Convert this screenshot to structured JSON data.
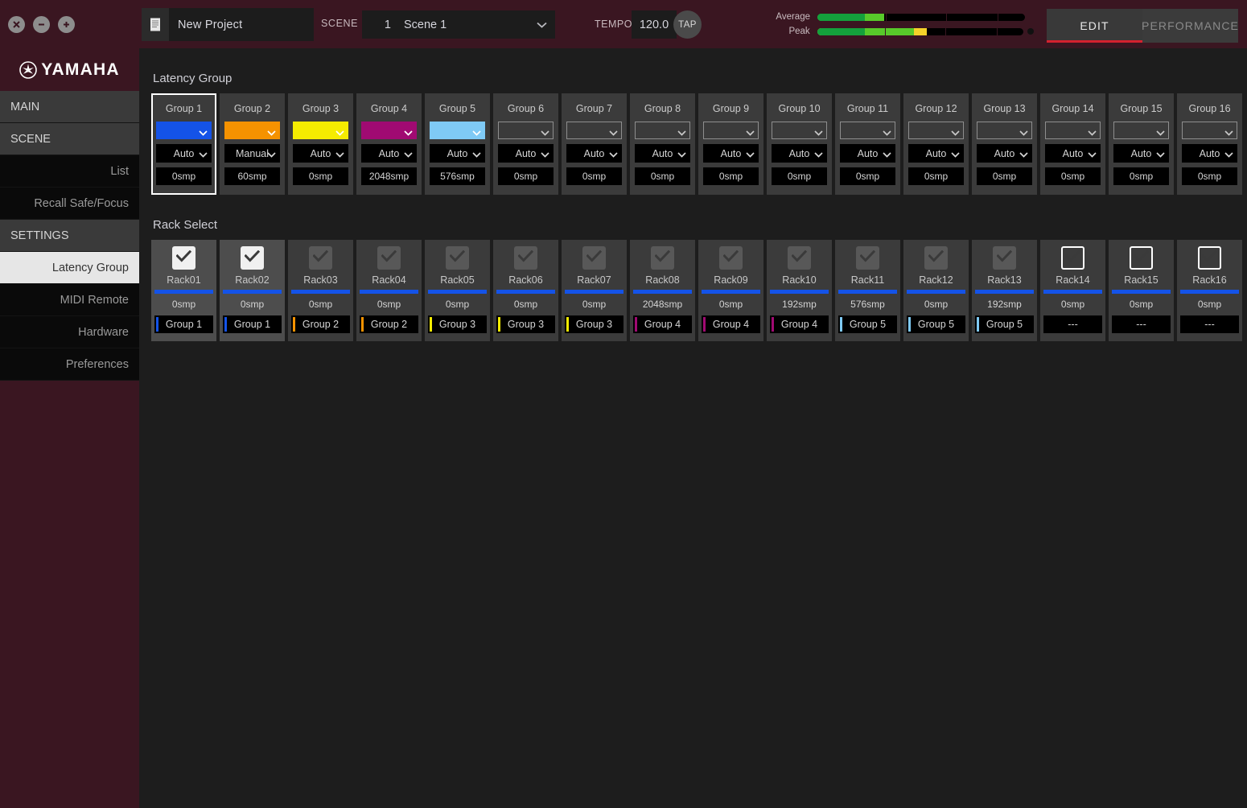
{
  "window": {
    "buttons": [
      {
        "name": "close",
        "glyph": "×"
      },
      {
        "name": "minimize",
        "glyph": "−"
      },
      {
        "name": "maximize",
        "glyph": "+"
      }
    ]
  },
  "header": {
    "project_name": "New Project",
    "project_icon": "document-icon",
    "scene_label": "SCENE",
    "scene_number": "1",
    "scene_name": "Scene 1",
    "tempo_label": "TEMPO",
    "tempo_value": "120.0",
    "tap_label": "TAP",
    "meters": [
      {
        "label": "Average",
        "value_pct": 32,
        "green_pct": 23,
        "lightgreen_pct": 32,
        "yellow_pct": 0,
        "has_dot": false
      },
      {
        "label": "Peak",
        "value_pct": 53,
        "green_pct": 23,
        "lightgreen_pct": 47,
        "yellow_pct": 53,
        "has_dot": true
      }
    ],
    "modes": [
      {
        "label": "EDIT",
        "active": true
      },
      {
        "label": "PERFORMANCE",
        "active": false
      }
    ],
    "accent_color": "#d4212f"
  },
  "sidebar": {
    "logo": "YAMAHA",
    "items": [
      {
        "label": "MAIN",
        "type": "head",
        "selected": false
      },
      {
        "label": "SCENE",
        "type": "head",
        "selected": false
      },
      {
        "label": "List",
        "type": "sub",
        "selected": false
      },
      {
        "label": "Recall Safe/Focus",
        "type": "sub",
        "selected": false
      },
      {
        "label": "SETTINGS",
        "type": "head",
        "selected": false
      },
      {
        "label": "Latency Group",
        "type": "sub",
        "selected": true
      },
      {
        "label": "MIDI Remote",
        "type": "sub",
        "selected": false
      },
      {
        "label": "Hardware",
        "type": "sub",
        "selected": false
      },
      {
        "label": "Preferences",
        "type": "sub",
        "selected": false
      }
    ]
  },
  "main": {
    "latency_group": {
      "title": "Latency Group",
      "groups": [
        {
          "name": "Group 1",
          "color": "#1453e8",
          "mode": "Auto",
          "samples": "0smp",
          "selected": true
        },
        {
          "name": "Group 2",
          "color": "#f59200",
          "mode": "Manual",
          "samples": "60smp",
          "selected": false
        },
        {
          "name": "Group 3",
          "color": "#f5ec00",
          "mode": "Auto",
          "samples": "0smp",
          "selected": false
        },
        {
          "name": "Group 4",
          "color": "#a00a72",
          "mode": "Auto",
          "samples": "2048smp",
          "selected": false
        },
        {
          "name": "Group 5",
          "color": "#7fcaf5",
          "mode": "Auto",
          "samples": "576smp",
          "selected": false
        },
        {
          "name": "Group 6",
          "color": "",
          "mode": "Auto",
          "samples": "0smp",
          "selected": false
        },
        {
          "name": "Group 7",
          "color": "",
          "mode": "Auto",
          "samples": "0smp",
          "selected": false
        },
        {
          "name": "Group 8",
          "color": "",
          "mode": "Auto",
          "samples": "0smp",
          "selected": false
        },
        {
          "name": "Group 9",
          "color": "",
          "mode": "Auto",
          "samples": "0smp",
          "selected": false
        },
        {
          "name": "Group 10",
          "color": "",
          "mode": "Auto",
          "samples": "0smp",
          "selected": false
        },
        {
          "name": "Group 11",
          "color": "",
          "mode": "Auto",
          "samples": "0smp",
          "selected": false
        },
        {
          "name": "Group 12",
          "color": "",
          "mode": "Auto",
          "samples": "0smp",
          "selected": false
        },
        {
          "name": "Group 13",
          "color": "",
          "mode": "Auto",
          "samples": "0smp",
          "selected": false
        },
        {
          "name": "Group 14",
          "color": "",
          "mode": "Auto",
          "samples": "0smp",
          "selected": false
        },
        {
          "name": "Group 15",
          "color": "",
          "mode": "Auto",
          "samples": "0smp",
          "selected": false
        },
        {
          "name": "Group 16",
          "color": "",
          "mode": "Auto",
          "samples": "0smp",
          "selected": false
        }
      ]
    },
    "rack_select": {
      "title": "Rack Select",
      "bar_color": "#1453e8",
      "racks": [
        {
          "name": "Rack01",
          "checkbox": "checked-bright",
          "samples": "0smp",
          "group": "Group 1",
          "group_color": "#1453e8"
        },
        {
          "name": "Rack02",
          "checkbox": "checked-bright",
          "samples": "0smp",
          "group": "Group 1",
          "group_color": "#1453e8"
        },
        {
          "name": "Rack03",
          "checkbox": "checked-dim",
          "samples": "0smp",
          "group": "Group 2",
          "group_color": "#f59200"
        },
        {
          "name": "Rack04",
          "checkbox": "checked-dim",
          "samples": "0smp",
          "group": "Group 2",
          "group_color": "#f59200"
        },
        {
          "name": "Rack05",
          "checkbox": "checked-dim",
          "samples": "0smp",
          "group": "Group 3",
          "group_color": "#f5ec00"
        },
        {
          "name": "Rack06",
          "checkbox": "checked-dim",
          "samples": "0smp",
          "group": "Group 3",
          "group_color": "#f5ec00"
        },
        {
          "name": "Rack07",
          "checkbox": "checked-dim",
          "samples": "0smp",
          "group": "Group 3",
          "group_color": "#f5ec00"
        },
        {
          "name": "Rack08",
          "checkbox": "checked-dim",
          "samples": "2048smp",
          "group": "Group 4",
          "group_color": "#a00a72"
        },
        {
          "name": "Rack09",
          "checkbox": "checked-dim",
          "samples": "0smp",
          "group": "Group 4",
          "group_color": "#a00a72"
        },
        {
          "name": "Rack10",
          "checkbox": "checked-dim",
          "samples": "192smp",
          "group": "Group 4",
          "group_color": "#a00a72"
        },
        {
          "name": "Rack11",
          "checkbox": "checked-dim",
          "samples": "576smp",
          "group": "Group 5",
          "group_color": "#7fcaf5"
        },
        {
          "name": "Rack12",
          "checkbox": "checked-dim",
          "samples": "0smp",
          "group": "Group 5",
          "group_color": "#7fcaf5"
        },
        {
          "name": "Rack13",
          "checkbox": "checked-dim",
          "samples": "192smp",
          "group": "Group 5",
          "group_color": "#7fcaf5"
        },
        {
          "name": "Rack14",
          "checkbox": "unchecked",
          "samples": "0smp",
          "group": "---",
          "group_color": ""
        },
        {
          "name": "Rack15",
          "checkbox": "unchecked",
          "samples": "0smp",
          "group": "---",
          "group_color": ""
        },
        {
          "name": "Rack16",
          "checkbox": "unchecked",
          "samples": "0smp",
          "group": "---",
          "group_color": ""
        }
      ]
    }
  }
}
